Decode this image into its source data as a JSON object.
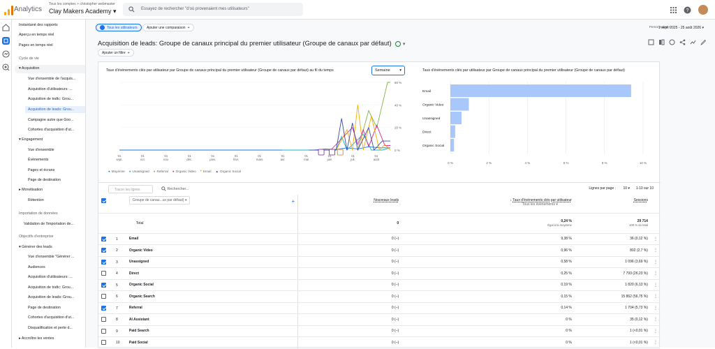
{
  "topbar": {
    "app_name": "Analytics",
    "account_crumb": "Tous les comptes > christopher webmaster",
    "property": "Clay Makers Academy",
    "search_placeholder": "Essayez de rechercher \"d'où provenaient mes utilisateurs\""
  },
  "nav": {
    "items": [
      "Instantané des rapports",
      "Aperçu en temps réel",
      "Pages en temps réel",
      "Cycle de vie",
      "Acquisition",
      "Vue d'ensemble de l'acquis...",
      "Acquisition d'utilisateurs: ...",
      "Acquisition de trafic: Grou...",
      "Acquisition de leads: Grou...",
      "Campagne autre que Goo...",
      "Cohortes d'acquisition d'ut...",
      "Engagement",
      "Vue d'ensemble",
      "Événements",
      "Pages et écrans",
      "Page de destination",
      "Monétisation",
      "Rétention",
      "Importation de données",
      "Validation de l'importation de...",
      "Objectifs d'entreprise",
      "Générer des leads",
      "Vue d'ensemble \"Générer ...",
      "Audiences",
      "Acquisition d'utilisateurs: ...",
      "Acquisition de trafic: Grou...",
      "Acquisition de leads: Grou...",
      "Page de destination",
      "Cohortes d'acquisition d'ut...",
      "Disqualification et perte d...",
      "Accroître les ventes"
    ]
  },
  "header": {
    "chip_all_users": "Tous les utilisateurs",
    "chip_add_comparison": "Ajouter une comparaison",
    "date_label": "Personnalisée",
    "date_range": "1 sept. 2025 - 25 août 2026",
    "title": "Acquisition de leads: Groupe de canaux principal du premier utilisateur (Groupe de canaux par défaut)",
    "add_filter": "Ajouter un filtre"
  },
  "line_chart": {
    "title": "Taux d'événements clés par utilisateur par Groupe de canaux principal du premier utilisateur (Groupe de canaux par défaut) au fil du temps",
    "granularity": "Semaine",
    "y_ticks": [
      "60 %",
      "40 %",
      "20 %",
      "0 %"
    ],
    "x_ticks": [
      "01\nsept.",
      "01\noct.",
      "01\nnov.",
      "01\ndéc.",
      "01\njanv.",
      "01\nfévr.",
      "01\nmars",
      "01\navr.",
      "01\nmai",
      "01\njuin",
      "01\njuil.",
      "01\naoût"
    ],
    "legend": [
      "Moyenne",
      "Unassigned",
      "Referral",
      "Organic Video",
      "Email",
      "Organic Social"
    ]
  },
  "bar_chart": {
    "title": "Taux d'événements clés par utilisateur par Groupe de canaux principal du premier utilisateur (Groupe de canaux par défaut)",
    "x_ticks": [
      "0 %",
      "2 %",
      "4 %",
      "6 %",
      "8 %",
      "10 %"
    ]
  },
  "chart_data": [
    {
      "type": "line",
      "y_unit": "%",
      "ylim": [
        0,
        60
      ],
      "x": [
        "01 sept.",
        "01 oct.",
        "01 nov.",
        "01 déc.",
        "01 janv.",
        "01 févr.",
        "01 mars",
        "01 avr.",
        "01 mai",
        "01 juin",
        "01 juil.",
        "01 août"
      ],
      "series": [
        {
          "name": "Moyenne",
          "color": "#1a73e8"
        },
        {
          "name": "Unassigned",
          "color": "#12b5cb"
        },
        {
          "name": "Referral",
          "color": "#7cb342"
        },
        {
          "name": "Organic Video",
          "color": "#e52592"
        },
        {
          "name": "Email",
          "color": "#f9ab00"
        },
        {
          "name": "Organic Social",
          "color": "#3949ab"
        }
      ]
    },
    {
      "type": "bar",
      "orientation": "horizontal",
      "categories": [
        "Email",
        "Organic Video",
        "Unassigned",
        "Direct",
        "Organic Social"
      ],
      "values": [
        9.38,
        0.96,
        0.58,
        0.25,
        0.19
      ],
      "xlim": [
        0,
        10
      ],
      "x_unit": "%"
    }
  ],
  "table": {
    "search_rows_placeholder": "Tracer les lignes",
    "search_placeholder": "Rechercher...",
    "rows_per_page_label": "Lignes par page :",
    "rows_per_page": "10",
    "range": "1-10 sur 10",
    "dimension_label": "Groupe de canau...ux par défaut)",
    "col_new_leads": "Nouveaux leads",
    "col_rate": "Taux d'événements clés par utilisateur",
    "col_rate_sub": "Tous les événements",
    "col_sessions": "Sessions",
    "total_label": "Total",
    "total_leads": "0",
    "total_rate": "0,24 %",
    "total_rate_sub": "Égal à la moyenne",
    "total_sessions": "29 714",
    "total_sessions_sub": "100 % du total",
    "rows": [
      {
        "n": "1",
        "name": "Email",
        "leads": "0 (–)",
        "rate": "9,38 %",
        "sessions": "36 (0,12 %)",
        "checked": true
      },
      {
        "n": "2",
        "name": "Organic Video",
        "leads": "0 (–)",
        "rate": "0,96 %",
        "sessions": "802 (2,7 %)",
        "checked": true
      },
      {
        "n": "3",
        "name": "Unassigned",
        "leads": "0 (–)",
        "rate": "0,58 %",
        "sessions": "1 096 (3,69 %)",
        "checked": true
      },
      {
        "n": "4",
        "name": "Direct",
        "leads": "0 (–)",
        "rate": "0,25 %",
        "sessions": "7 793 (26,23 %)",
        "checked": false
      },
      {
        "n": "5",
        "name": "Organic Social",
        "leads": "0 (–)",
        "rate": "0,19 %",
        "sessions": "1 820 (6,13 %)",
        "checked": true
      },
      {
        "n": "6",
        "name": "Organic Search",
        "leads": "0 (–)",
        "rate": "0,15 %",
        "sessions": "15 862 (56,75 %)",
        "checked": false
      },
      {
        "n": "7",
        "name": "Referral",
        "leads": "0 (–)",
        "rate": "0,14 %",
        "sessions": "1 704 (5,73 %)",
        "checked": true
      },
      {
        "n": "8",
        "name": "AI Assistant",
        "leads": "0 (–)",
        "rate": "0 %",
        "sessions": "35 (0,12 %)",
        "checked": false
      },
      {
        "n": "9",
        "name": "Paid Search",
        "leads": "0 (–)",
        "rate": "0 %",
        "sessions": "1 (<0,01 %)",
        "checked": false
      },
      {
        "n": "10",
        "name": "Paid Social",
        "leads": "0 (–)",
        "rate": "0 %",
        "sessions": "1 (<0,01 %)",
        "checked": false
      }
    ]
  }
}
